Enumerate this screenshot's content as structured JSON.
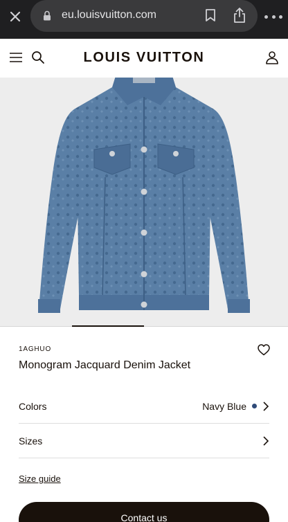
{
  "browser": {
    "url": "eu.louisvuitton.com",
    "icons": [
      "close-icon",
      "lock-icon",
      "bookmark-icon",
      "share-icon",
      "more-icon"
    ]
  },
  "header": {
    "brand": "LOUIS VUITTON",
    "icons": [
      "menu-icon",
      "search-icon",
      "account-icon"
    ]
  },
  "gallery": {
    "image": "denim-jacket-image",
    "current_slide_fraction": 0.25
  },
  "product": {
    "sku": "1AGHUO",
    "title": "Monogram Jacquard Denim Jacket",
    "favorite_icon": "heart-icon"
  },
  "options": {
    "colors_label": "Colors",
    "colors_value": "Navy Blue",
    "color_swatch": "#2f4a78",
    "sizes_label": "Sizes"
  },
  "links": {
    "size_guide": "Size guide"
  },
  "cta": {
    "contact": "Contact us"
  },
  "colors": {
    "accent": "#19110b",
    "browser_bar": "#1f1f21",
    "image_bg": "#ededed"
  }
}
